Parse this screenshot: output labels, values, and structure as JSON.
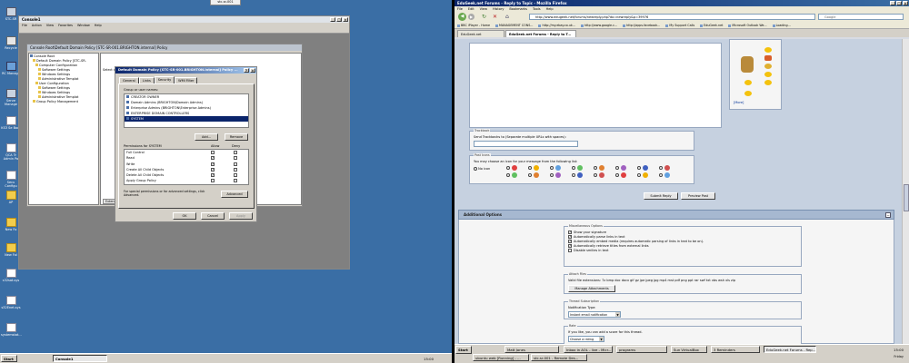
{
  "left": {
    "rdp_tab": "stc-sr-001",
    "desktop_icons": [
      {
        "label": "STC-SR",
        "kind": "pc"
      },
      {
        "label": "Recycle",
        "kind": "bin"
      },
      {
        "label": "RC Manage",
        "kind": "net"
      },
      {
        "label": "Serve Manage",
        "kind": "pc"
      },
      {
        "label": "KS3 Se Boot",
        "kind": "doc"
      },
      {
        "label": "QCA Tr Admin Po",
        "kind": "doc"
      },
      {
        "label": "Secu Configu",
        "kind": "doc"
      },
      {
        "label": "AP",
        "kind": "folder"
      },
      {
        "label": "New Fo",
        "kind": "folder"
      },
      {
        "label": "New Fol",
        "kind": "folder"
      },
      {
        "label": "s32sat.sys",
        "kind": "doc"
      },
      {
        "label": "s32Enet.sys",
        "kind": "doc"
      },
      {
        "label": "systemstat...",
        "kind": "doc"
      }
    ],
    "console": {
      "title": "Console1",
      "menu": [
        "File",
        "Action",
        "View",
        "Favorites",
        "Window",
        "Help"
      ],
      "inner_title": "Console Root\\Default Domain Policy [STC-SR-001.BRIGHTON.internal] Policy",
      "tree": [
        "Console Root",
        "Default Domain Policy [STC-SR-",
        "Computer Configuration",
        "Software Settings",
        "Windows Settings",
        "Administrative Templat",
        "User Configuration",
        "Software Settings",
        "Windows Settings",
        "Administrative Templat",
        "Group Policy Management"
      ],
      "extended_tab": "Extended",
      "select_item_text": "Select an item"
    },
    "dialog": {
      "title": "Default Domain Policy [STC-SR-001.BRIGHTON.internal] Policy ...",
      "tabs": [
        "General",
        "Links",
        "Security",
        "WMI Filter"
      ],
      "group_label": "Group or user names:",
      "users": [
        "CREATOR OWNER",
        "Domain Admins (BRIGHTON\\Domain Admins)",
        "Enterprise Admins (BRIGHTON\\Enterprise Admins)",
        "ENTERPRISE DOMAIN CONTROLLERS",
        "SYSTEM"
      ],
      "add_label": "Add...",
      "remove_label": "Remove",
      "perm_label": "Permissions for SYSTEM",
      "allow_label": "Allow",
      "deny_label": "Deny",
      "permissions": [
        {
          "name": "Full Control",
          "allow": false
        },
        {
          "name": "Read",
          "allow": true
        },
        {
          "name": "Write",
          "allow": true
        },
        {
          "name": "Create All Child Objects",
          "allow": true
        },
        {
          "name": "Delete All Child Objects",
          "allow": true
        },
        {
          "name": "Apply Group Policy",
          "allow": false
        }
      ],
      "special_text": "For special permissions or for advanced settings, click Advanced.",
      "advanced_label": "Advanced",
      "ok_label": "OK",
      "cancel_label": "Cancel",
      "apply_label": "Apply"
    },
    "taskbar": {
      "start": "Start",
      "task": "Console1",
      "time": "15:00"
    }
  },
  "right": {
    "window_title": "EduGeek.net Forums - Reply to Topic - Mozilla Firefox",
    "menu": [
      "File",
      "Edit",
      "View",
      "History",
      "Bookmarks",
      "Tools",
      "Help"
    ],
    "url": "http://www.edugeek.net/forums/newreply.php?do=newreply&p=39976",
    "search_placeholder": "Google",
    "bookmarks": [
      "BBC iPlayer - Home",
      "MANAGEMENT CONS...",
      "http://my.ebay.co.uk...",
      "http://www.google.c...",
      "http://apps.facebook...",
      "My Support Calls",
      "EduGeek.net",
      "Microsoft Outlook We...",
      "Loading..."
    ],
    "tabs": [
      "EduGeek.net",
      "EduGeek.net Forums - Reply to T..."
    ],
    "smilies_more": "[More]",
    "trackback_legend": "Trackback",
    "trackback_label": "Send Trackbacks to (Separate multiple URLs with spaces):",
    "posticons_legend": "Post Icons",
    "posticons_label": "You may choose an icon for your message from the following list:",
    "no_icon": "No icon",
    "submit_label": "Submit Reply",
    "preview_label": "Preview Post",
    "additional_title": "Additional Options",
    "misc_legend": "Miscellaneous Options",
    "misc_options": [
      {
        "label": "Show your signature",
        "checked": true
      },
      {
        "label": "Automatically parse links in text",
        "checked": true
      },
      {
        "label": "Automatically embed media (requires automatic parsing of links in text to be on).",
        "checked": true
      },
      {
        "label": "Automatically retrieve titles from external links",
        "checked": true
      },
      {
        "label": "Disable smilies in text",
        "checked": false
      }
    ],
    "attach_legend": "Attach Files",
    "attach_text": "Valid file extensions: 7z bmp doc docx gif gz jpe jpeg jpg mp4 mst pdf png ppt rar swf txt vbs wsh xls zip",
    "manage_attach": "Manage Attachments",
    "thread_legend": "Thread Subscription",
    "notify_label": "Notification Type:",
    "notify_value": "Instant email notification",
    "rate_legend": "Rate",
    "rate_text": "If you like, you can add a score for this thread.",
    "rate_value": "Choose a rating",
    "taskbar": {
      "start": "Start",
      "row1": [
        "Matt Jones",
        "Inbox in AOL - live - Micr...",
        "programs",
        "Sun VirtualBox",
        "3 Reminders",
        "EduGeek.net Forums - Rep..."
      ],
      "row2": [
        "ubuntu web [Running] - ...",
        "stc-sr-001 - Remote Des..."
      ],
      "time": "15:00",
      "day": "Friday"
    }
  }
}
